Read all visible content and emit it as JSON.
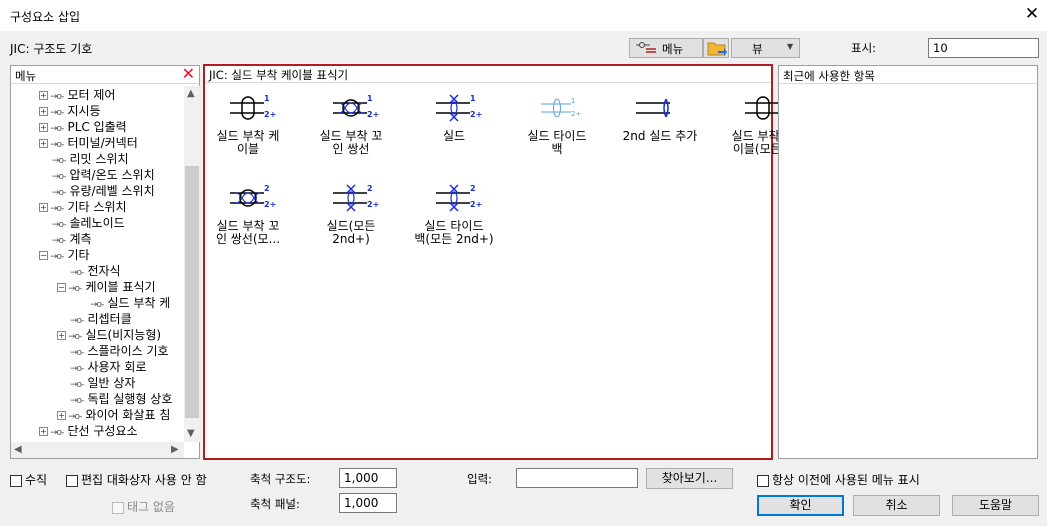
{
  "window": {
    "title": "구성요소 삽입",
    "close_glyph": "✕"
  },
  "library_label": "JIC: 구조도 기호",
  "toolbar": {
    "menu_label": "메뉴",
    "view_label": "뷰",
    "show_label": "표시:",
    "show_value": "10"
  },
  "menu_panel": {
    "title": "메뉴",
    "tree": [
      {
        "label": "모터 제어",
        "level": 0,
        "expander": "+"
      },
      {
        "label": "지시등",
        "level": 0,
        "expander": "+"
      },
      {
        "label": "PLC 입출력",
        "level": 0,
        "expander": "+"
      },
      {
        "label": "터미널/커넥터",
        "level": 0,
        "expander": "+"
      },
      {
        "label": "리밋 스위치",
        "level": 0,
        "expander": ""
      },
      {
        "label": "압력/온도 스위치",
        "level": 0,
        "expander": ""
      },
      {
        "label": "유량/레벨 스위치",
        "level": 0,
        "expander": ""
      },
      {
        "label": "기타 스위치",
        "level": 0,
        "expander": "+"
      },
      {
        "label": "솔레노이드",
        "level": 0,
        "expander": ""
      },
      {
        "label": "계측",
        "level": 0,
        "expander": ""
      },
      {
        "label": "기타",
        "level": 0,
        "expander": "−"
      },
      {
        "label": "전자식",
        "level": 1,
        "expander": ""
      },
      {
        "label": "케이블 표식기",
        "level": 1,
        "expander": "−"
      },
      {
        "label": "실드 부착 케",
        "level": 2,
        "expander": ""
      },
      {
        "label": "리셉터클",
        "level": 1,
        "expander": ""
      },
      {
        "label": "실드(비지능형)",
        "level": 1,
        "expander": "+"
      },
      {
        "label": "스플라이스 기호",
        "level": 1,
        "expander": ""
      },
      {
        "label": "사용자 회로",
        "level": 1,
        "expander": ""
      },
      {
        "label": "일반 상자",
        "level": 1,
        "expander": ""
      },
      {
        "label": "독립 실행형 상호",
        "level": 1,
        "expander": ""
      },
      {
        "label": "와이어 화살표 침",
        "level": 1,
        "expander": "+"
      },
      {
        "label": "단선 구성요소",
        "level": 0,
        "expander": "+"
      }
    ]
  },
  "symbols_panel": {
    "title": "JIC: 실드 부착 케이블 표식기",
    "symbols": [
      {
        "label1": "실드 부착 케",
        "label2": "이블",
        "icon": "shield-cable-icon"
      },
      {
        "label1": "실드 부착 꼬",
        "label2": "인 쌍선",
        "icon": "shield-twisted-pair-icon"
      },
      {
        "label1": "실드",
        "label2": "",
        "icon": "shield-icon"
      },
      {
        "label1": "실드 타이드",
        "label2": "백",
        "icon": "shield-tie-back-icon"
      },
      {
        "label1": "2nd 실드 추가",
        "label2": "",
        "icon": "add-2nd-shield-icon"
      },
      {
        "label1": "실드 부착 케",
        "label2": "이블(모든...",
        "icon": "shield-cable-all-icon"
      },
      {
        "label1": "실드 부착 꼬",
        "label2": "인 쌍선(모...",
        "icon": "shield-twisted-pair-all-icon"
      },
      {
        "label1": "실드(모든",
        "label2": "2nd+)",
        "icon": "shield-all-icon"
      },
      {
        "label1": "실드 타이드",
        "label2": "백(모든 2nd+)",
        "icon": "shield-tie-back-all-icon"
      }
    ],
    "symbol_text_1": "1",
    "symbol_text_2": "2",
    "symbol_text_2plus": "2+"
  },
  "recent_panel": {
    "title": "최근에 사용한 항목"
  },
  "bottom": {
    "vertical_label": "수직",
    "no_edit_dialog_label": "편집 대화상자 사용 안 함",
    "no_tag_label": "태그 없음",
    "scale_schematic_label": "축척 구조도:",
    "scale_schematic_value": "1,000",
    "scale_panel_label": "축척 패널:",
    "scale_panel_value": "1,000",
    "input_label": "입력:",
    "input_value": "",
    "browse_label": "찾아보기...",
    "always_show_label": "항상 이전에 사용된 메뉴 표시",
    "ok_label": "확인",
    "cancel_label": "취소",
    "help_label": "도움말"
  }
}
